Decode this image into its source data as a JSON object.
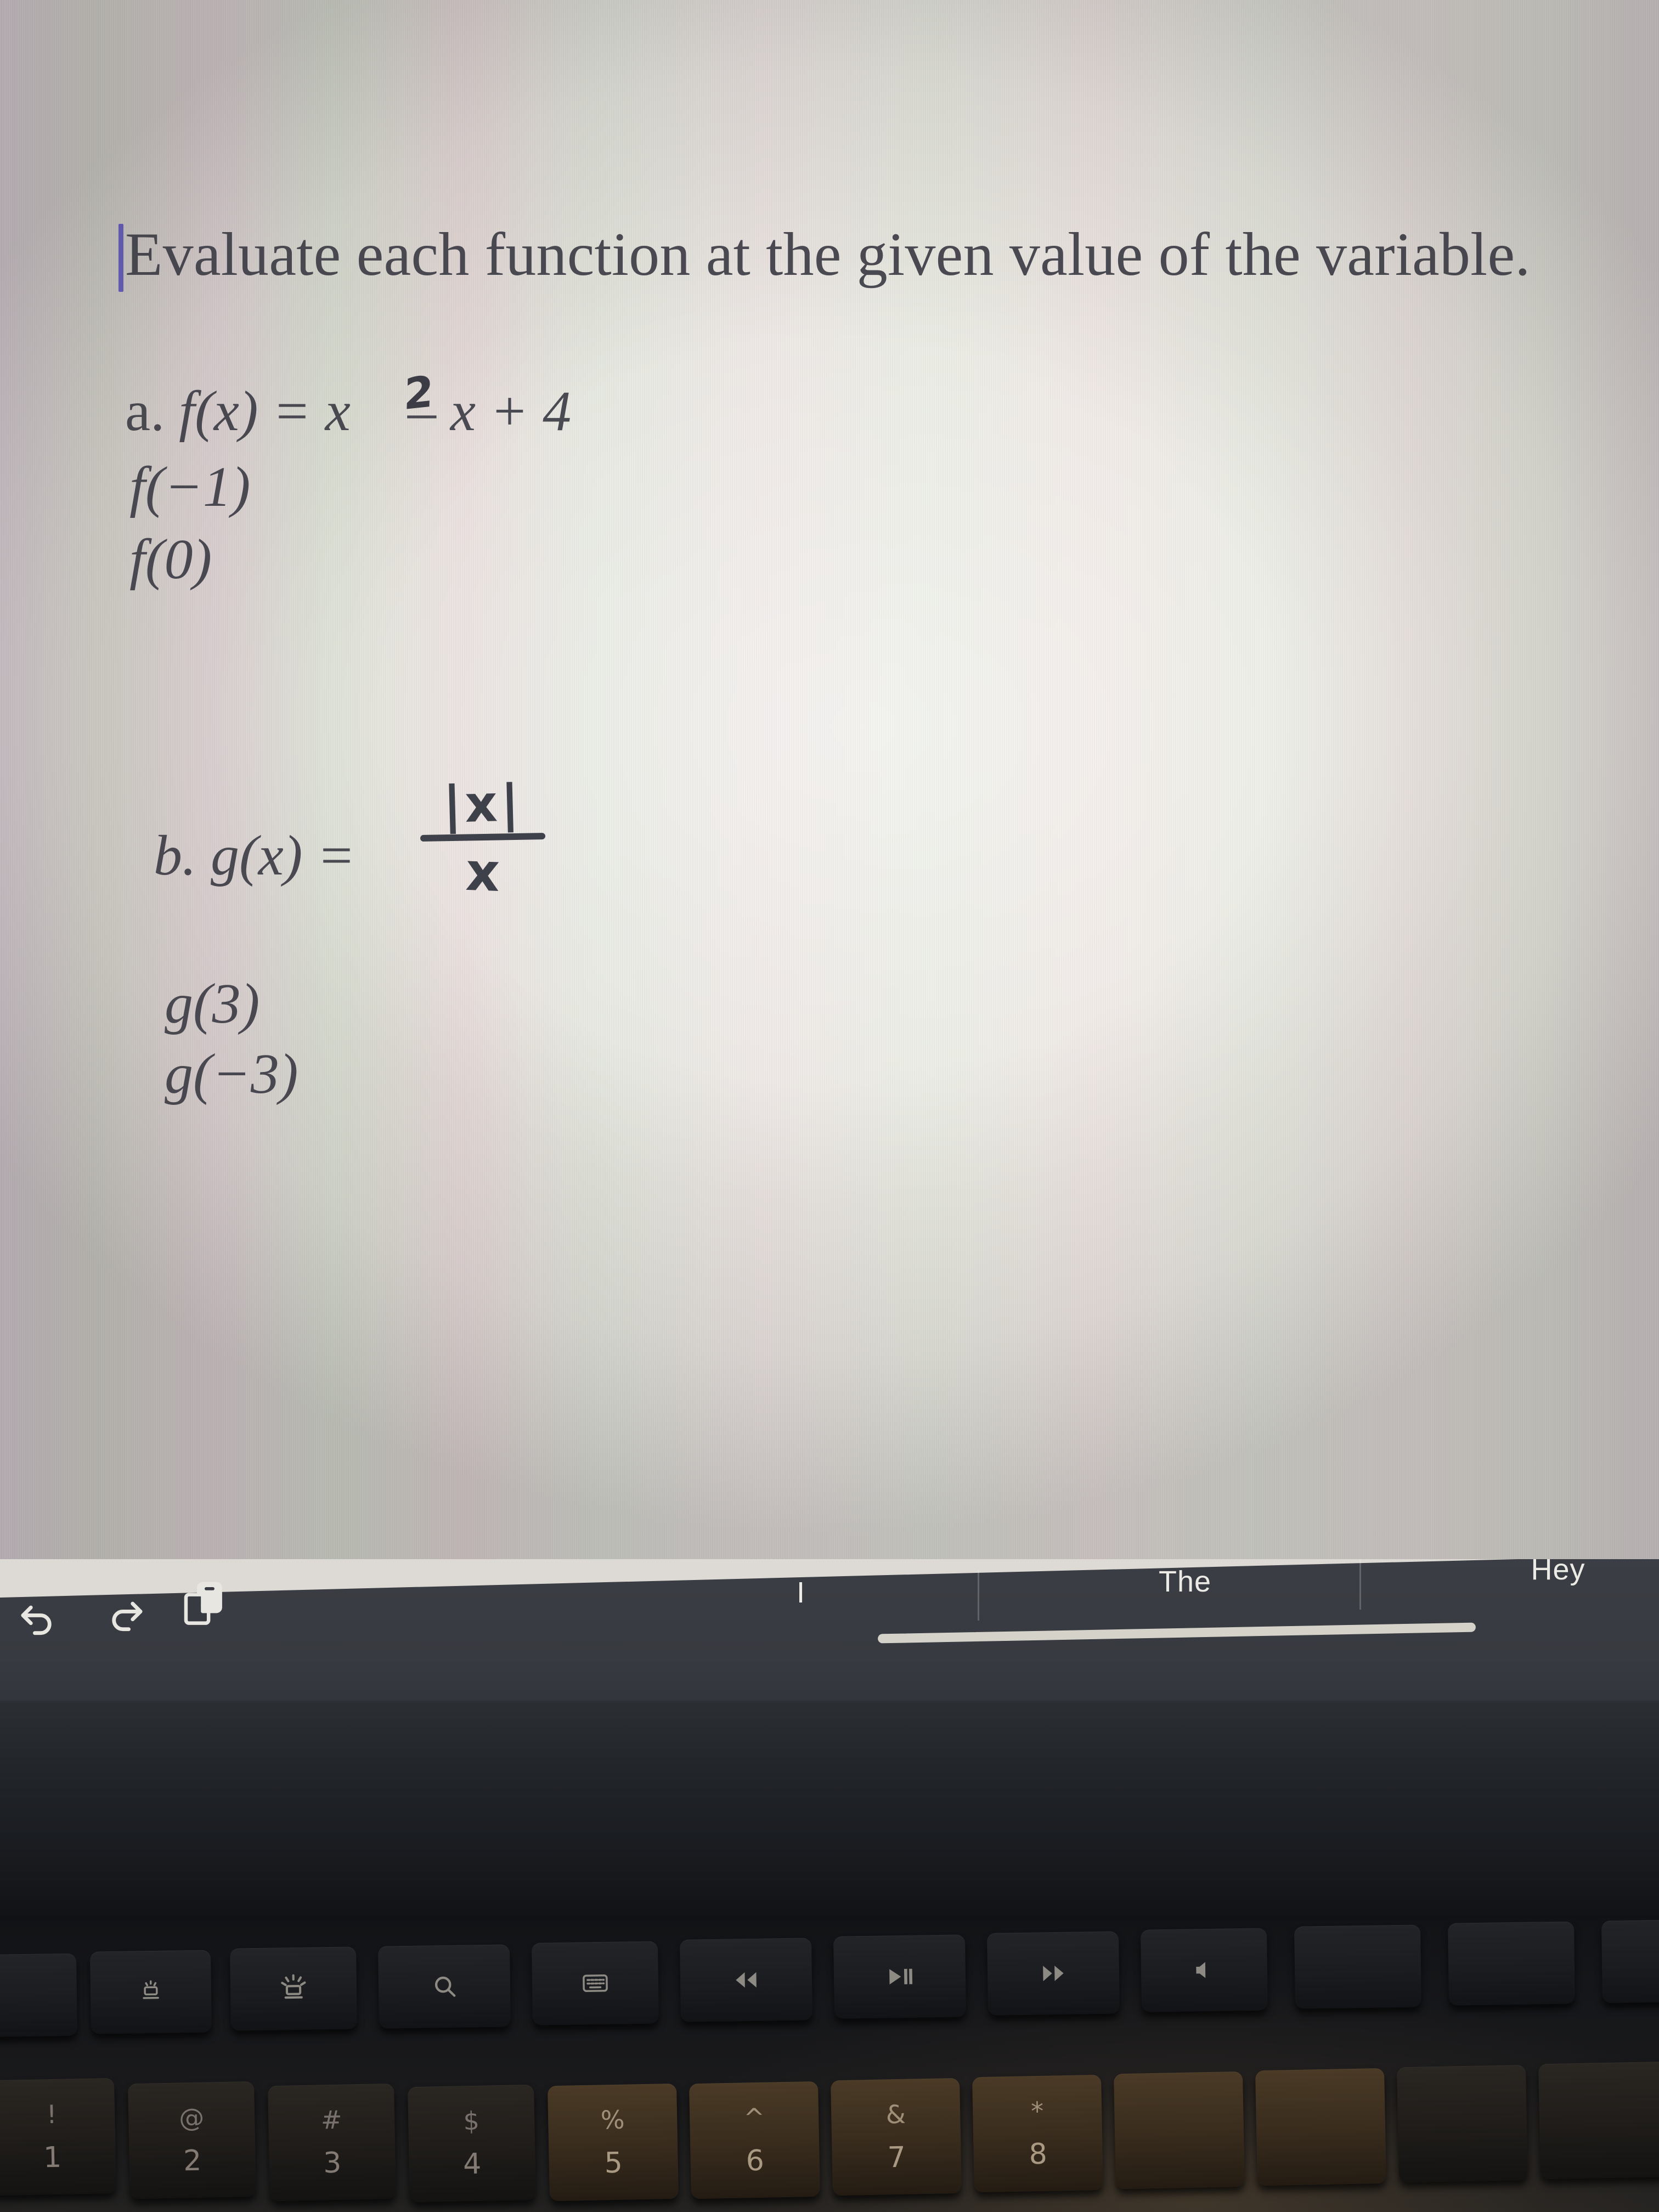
{
  "document": {
    "prompt": "Evaluate each function at the given value of the variable.",
    "caret_color": "#6a62c8",
    "text_color": "#4a4a52",
    "parts": [
      {
        "id": "a",
        "label": "a.",
        "function_name": "f",
        "definition_lhs": "f(x) =",
        "definition_rhs_base": "x",
        "definition_exponent": "2",
        "definition_rhs_tail": "– x + 4",
        "definition_full": "a. f(x) = x² – x + 4",
        "evaluations": [
          "f(−1)",
          "f(0)"
        ]
      },
      {
        "id": "b",
        "label": "b.",
        "function_name": "g",
        "definition_lhs": "b. g(x) =",
        "handwritten_numerator": "|x|",
        "handwritten_denominator": "x",
        "definition_full": "b. g(x) = |x| / x",
        "evaluations": [
          "g(3)",
          "g(−3)"
        ]
      }
    ]
  },
  "keyboard_accessory_bar": {
    "background_color": "#373a40",
    "tools": [
      {
        "name": "undo",
        "icon": "undo-icon"
      },
      {
        "name": "redo",
        "icon": "redo-icon"
      },
      {
        "name": "paste",
        "icon": "paste-icon"
      }
    ],
    "predictive_suggestions": [
      "I",
      "The",
      "Hey"
    ],
    "home_indicator_color": "#d5d2ca"
  },
  "laptop_keyboard": {
    "function_row": [
      {
        "key": "f4",
        "glyph": "",
        "icon": "keyboard-backlight-down-icon"
      },
      {
        "key": "f5",
        "glyph": "",
        "icon": "keyboard-backlight-up-icon"
      },
      {
        "key": "f6",
        "glyph": "⌕",
        "icon": "search-icon"
      },
      {
        "key": "f7",
        "glyph": "",
        "icon": "dictation-keyboard-icon"
      },
      {
        "key": "f8",
        "glyph": "◀◀",
        "icon": "rewind-icon"
      },
      {
        "key": "f9",
        "glyph": "▶‖",
        "icon": "play-pause-icon"
      },
      {
        "key": "f10",
        "glyph": "▶▶",
        "icon": "fast-forward-icon"
      },
      {
        "key": "f11",
        "glyph": "◂",
        "icon": "volume-down-icon"
      }
    ],
    "number_row": [
      {
        "symbol": "!",
        "number": "1"
      },
      {
        "symbol": "@",
        "number": "2"
      },
      {
        "symbol": "#",
        "number": "3"
      },
      {
        "symbol": "$",
        "number": "4"
      },
      {
        "symbol": "%",
        "number": "5"
      },
      {
        "symbol": "^",
        "number": "6"
      },
      {
        "symbol": "&",
        "number": "7"
      },
      {
        "symbol": "*",
        "number": "8"
      }
    ]
  }
}
